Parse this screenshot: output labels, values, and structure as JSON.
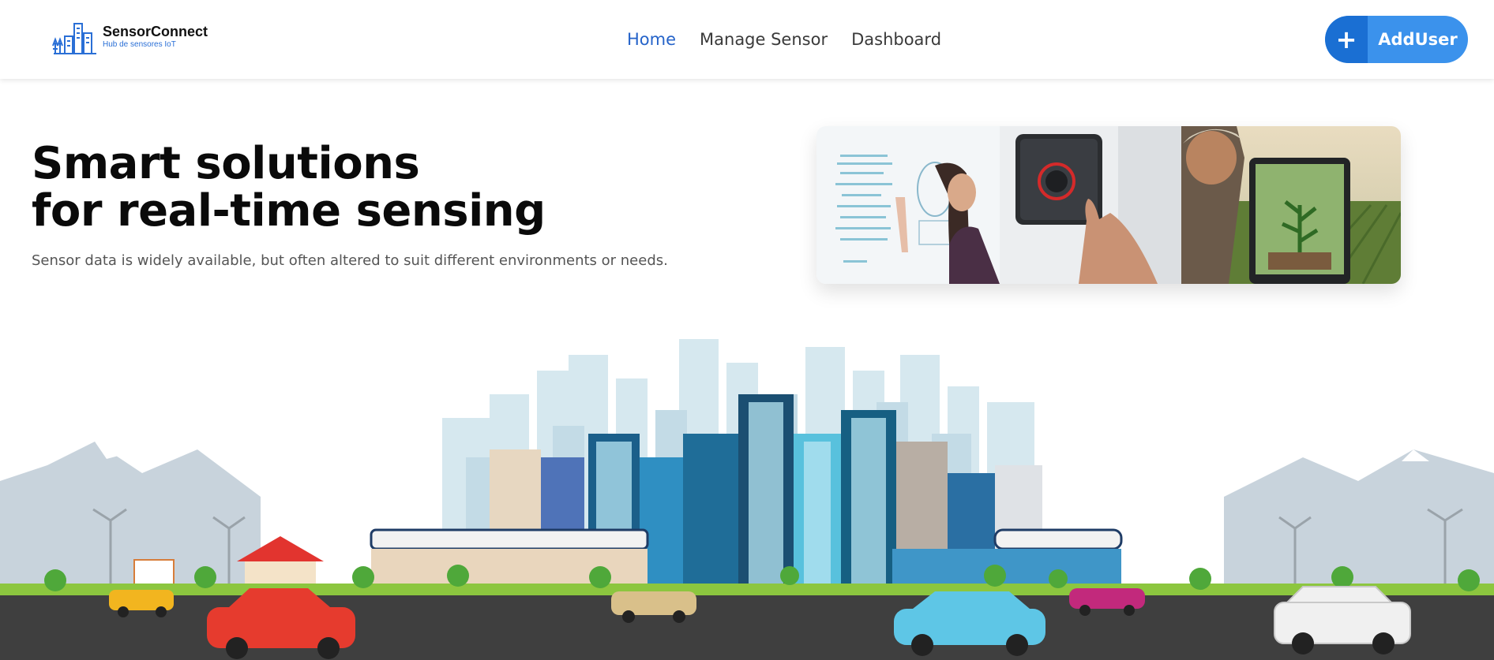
{
  "brand": {
    "name": "SensorConnect",
    "tagline": "Hub de sensores IoT"
  },
  "nav": {
    "items": [
      {
        "label": "Home",
        "active": true
      },
      {
        "label": "Manage Sensor",
        "active": false
      },
      {
        "label": "Dashboard",
        "active": false
      }
    ]
  },
  "actions": {
    "add_user_icon": "+",
    "add_user_label": "AddUser"
  },
  "hero": {
    "title_line1": "Smart solutions",
    "title_line2": "for real-time sensing",
    "subtitle": "Sensor data is widely available, but often altered to suit different environments or needs."
  },
  "colors": {
    "accent": "#2563c9",
    "button": "#3b92ec",
    "button_dark": "#1a6fd3",
    "road": "#3f3f3f",
    "grass": "#8cc63f"
  },
  "icons": {
    "logo": "city-buildings-icon",
    "add": "plus-icon"
  }
}
